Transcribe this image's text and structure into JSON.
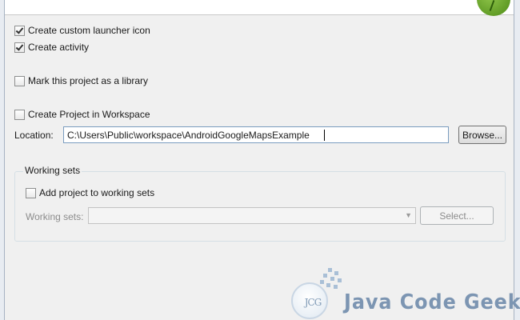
{
  "options": {
    "create_launcher_icon": {
      "label": "Create custom launcher icon",
      "checked": true
    },
    "create_activity": {
      "label": "Create activity",
      "checked": true
    },
    "mark_library": {
      "label": "Mark this project as a library",
      "checked": false
    },
    "create_in_workspace": {
      "label": "Create Project in Workspace",
      "checked": false
    }
  },
  "location": {
    "label": "Location:",
    "value": "C:\\Users\\Public\\workspace\\AndroidGoogleMapsExample",
    "browse_label": "Browse..."
  },
  "working_sets": {
    "group_title": "Working sets",
    "add_label": "Add project to working sets",
    "add_checked": false,
    "sets_label": "Working sets:",
    "sets_value": "",
    "select_label": "Select..."
  },
  "watermark": {
    "logo_text": "JCG",
    "brand": "Java Code Geeks"
  },
  "icons": {
    "banner_logo": "android-eclipse-logo-icon",
    "combo_arrow": "chevron-down-icon"
  },
  "colors": {
    "window_bg": "#f0f0f0",
    "input_border": "#7a9cbf",
    "watermark": "#7c95b2"
  }
}
